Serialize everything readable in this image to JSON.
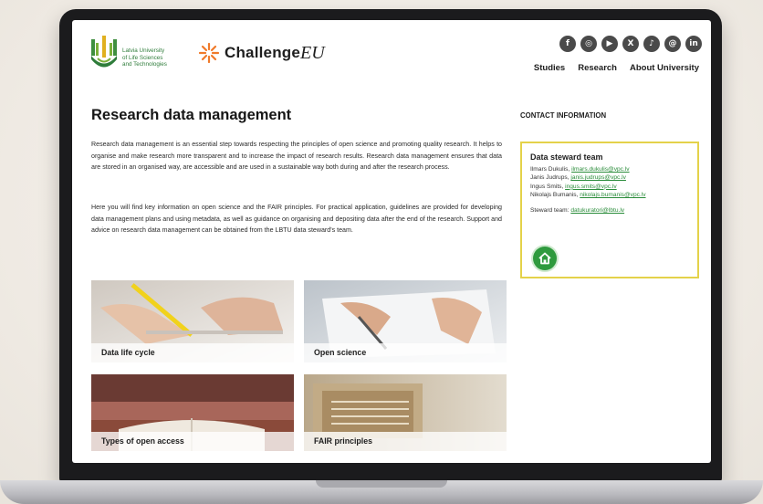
{
  "header": {
    "university_logo_text": [
      "Latvia University",
      "of Life Sciences",
      "and Technologies"
    ],
    "challenge_word": "Challenge",
    "challenge_eu": "EU",
    "socials": [
      {
        "icon": "facebook-icon",
        "glyph": "f"
      },
      {
        "icon": "instagram-icon",
        "glyph": "◎"
      },
      {
        "icon": "youtube-icon",
        "glyph": "▶"
      },
      {
        "icon": "x-icon",
        "glyph": "X"
      },
      {
        "icon": "tiktok-icon",
        "glyph": "♪"
      },
      {
        "icon": "threads-icon",
        "glyph": "@"
      },
      {
        "icon": "linkedin-icon",
        "glyph": "in"
      }
    ],
    "nav": [
      "Studies",
      "Research",
      "About University"
    ]
  },
  "main": {
    "title": "Research data management",
    "paragraph1": "Research data management is an essential step towards respecting the principles of open science and promoting quality research. It helps to organise and make research more transparent and to increase the impact of research results. Research data management ensures that data are stored in an organised way, are accessible and are used in a sustainable way both during and after the research process.",
    "paragraph2": "Here you will find key information on open science and the FAIR principles. For practical application, guidelines are provided for developing data management plans and using metadata, as well as guidance on organising and depositing data after the end of the research. Support and advice on research data management can be obtained from the LBTU data steward's team.",
    "cards": [
      "Data life cycle",
      "Open science",
      "Types of open access",
      "FAIR principles"
    ]
  },
  "contact": {
    "heading": "CONTACT INFORMATION",
    "team_title": "Data steward team",
    "members": [
      {
        "name": "Ilmars Dukulis, ",
        "email": "ilmars.dukulis@vpc.lv"
      },
      {
        "name": "Janis Judrups, ",
        "email": "janis.judrups@vpc.lv"
      },
      {
        "name": "Ingus Smits, ",
        "email": "ingus.smits@vpc.lv"
      },
      {
        "name": "Nikolajs Bumanis, ",
        "email": "nikolajs.bumanis@vpc.lv"
      }
    ],
    "team_label": "Steward team: ",
    "team_email": "datukuratori@lbtu.lv"
  },
  "colors": {
    "accent_green": "#2f9a3e",
    "box_border": "#e4d24a",
    "social_bg": "#4a4a4a"
  }
}
